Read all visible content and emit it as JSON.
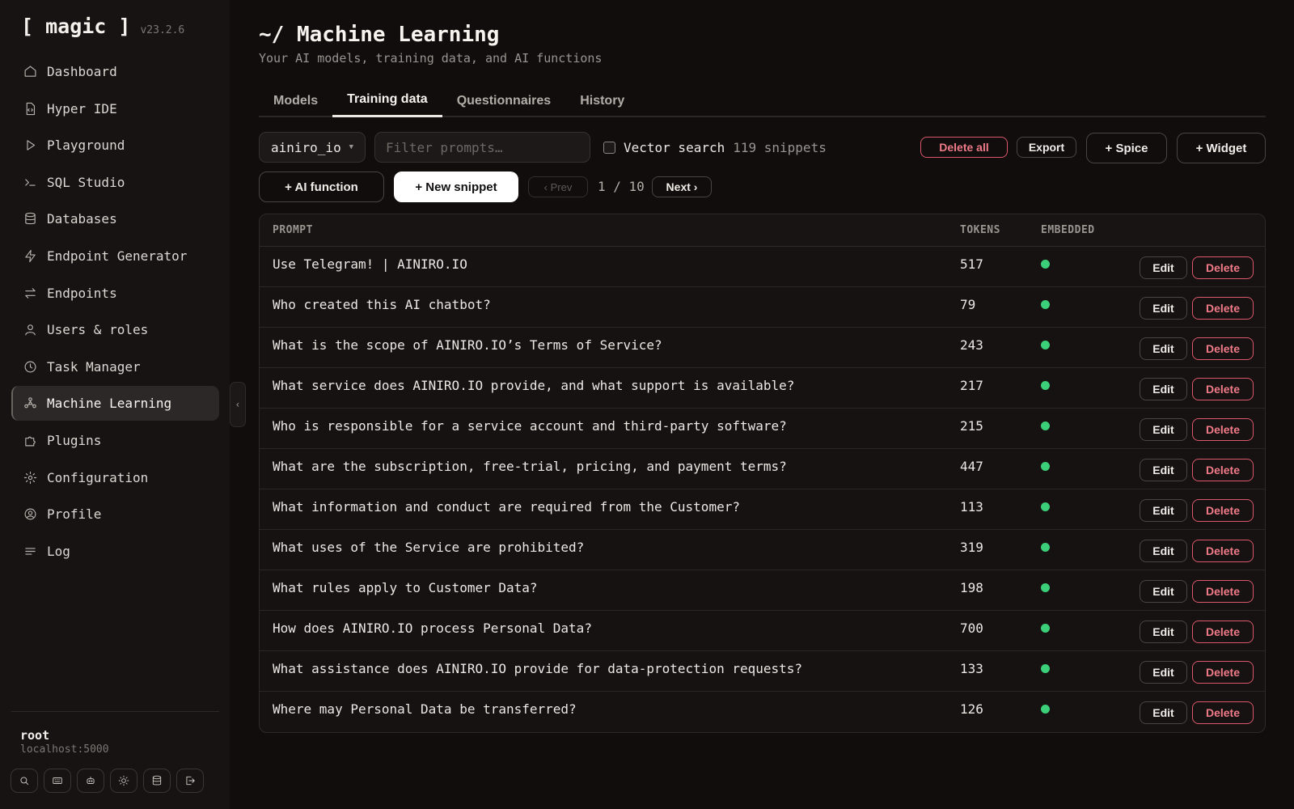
{
  "app": {
    "name": "[ magic ]",
    "version": "v23.2.6"
  },
  "sidebar": {
    "items": [
      {
        "label": "Dashboard",
        "icon": "home-icon"
      },
      {
        "label": "Hyper IDE",
        "icon": "code-file-icon"
      },
      {
        "label": "Playground",
        "icon": "play-icon"
      },
      {
        "label": "SQL Studio",
        "icon": "terminal-icon"
      },
      {
        "label": "Databases",
        "icon": "database-icon"
      },
      {
        "label": "Endpoint Generator",
        "icon": "lightning-icon"
      },
      {
        "label": "Endpoints",
        "icon": "arrows-icon"
      },
      {
        "label": "Users & roles",
        "icon": "user-icon"
      },
      {
        "label": "Task Manager",
        "icon": "clock-icon"
      },
      {
        "label": "Machine Learning",
        "icon": "network-icon",
        "active": true
      },
      {
        "label": "Plugins",
        "icon": "puzzle-icon"
      },
      {
        "label": "Configuration",
        "icon": "gear-icon"
      },
      {
        "label": "Profile",
        "icon": "user-circle-icon"
      },
      {
        "label": "Log",
        "icon": "lines-icon"
      }
    ],
    "user": {
      "name": "root",
      "host": "localhost:5000"
    },
    "bottom_icons": [
      "search-icon",
      "keyboard-icon",
      "robot-icon",
      "sun-icon",
      "database-icon",
      "logout-icon"
    ]
  },
  "header": {
    "title": "~/ Machine Learning",
    "subtitle": "Your AI models, training data, and AI functions"
  },
  "tabs": [
    {
      "label": "Models"
    },
    {
      "label": "Training data",
      "active": true
    },
    {
      "label": "Questionnaires"
    },
    {
      "label": "History"
    }
  ],
  "toolbar": {
    "model_select": "ainiro_io",
    "filter_placeholder": "Filter prompts…",
    "vector_search_label": "Vector search",
    "snippet_count": "119 snippets",
    "delete_all": "Delete all",
    "export": "Export",
    "spice": "+ Spice",
    "widget": "+ Widget",
    "ai_function": "+ AI function",
    "new_snippet": "+ New snippet",
    "prev": "‹ Prev",
    "page": "1 / 10",
    "next": "Next ›"
  },
  "table": {
    "headers": {
      "prompt": "PROMPT",
      "tokens": "TOKENS",
      "embedded": "EMBEDDED"
    },
    "edit_label": "Edit",
    "delete_label": "Delete",
    "embedded_color": "#3ccf7a",
    "rows": [
      {
        "prompt": "Use Telegram! | AINIRO.IO",
        "tokens": "517",
        "embedded": true
      },
      {
        "prompt": "Who created this AI chatbot?",
        "tokens": "79",
        "embedded": true
      },
      {
        "prompt": "What is the scope of AINIRO.IO’s Terms of Service?",
        "tokens": "243",
        "embedded": true
      },
      {
        "prompt": "What service does AINIRO.IO provide, and what support is available?",
        "tokens": "217",
        "embedded": true
      },
      {
        "prompt": "Who is responsible for a service account and third-party software?",
        "tokens": "215",
        "embedded": true
      },
      {
        "prompt": "What are the subscription, free-trial, pricing, and payment terms?",
        "tokens": "447",
        "embedded": true
      },
      {
        "prompt": "What information and conduct are required from the Customer?",
        "tokens": "113",
        "embedded": true
      },
      {
        "prompt": "What uses of the Service are prohibited?",
        "tokens": "319",
        "embedded": true
      },
      {
        "prompt": "What rules apply to Customer Data?",
        "tokens": "198",
        "embedded": true
      },
      {
        "prompt": "How does AINIRO.IO process Personal Data?",
        "tokens": "700",
        "embedded": true
      },
      {
        "prompt": "What assistance does AINIRO.IO provide for data-protection requests?",
        "tokens": "133",
        "embedded": true
      },
      {
        "prompt": "Where may Personal Data be transferred?",
        "tokens": "126",
        "embedded": true
      }
    ]
  }
}
